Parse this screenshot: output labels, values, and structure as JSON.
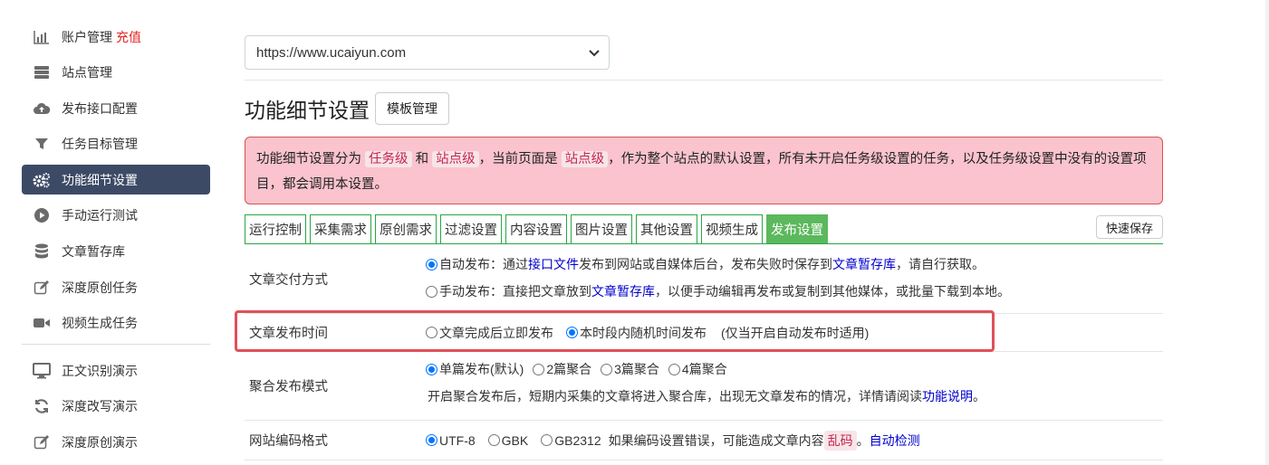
{
  "sidebar": {
    "items": [
      {
        "label": "账户管理",
        "icon": "bar-chart-icon",
        "extra": "充值"
      },
      {
        "label": "站点管理",
        "icon": "server-icon"
      },
      {
        "label": "发布接口配置",
        "icon": "cloud-upload-icon"
      },
      {
        "label": "任务目标管理",
        "icon": "filter-icon"
      },
      {
        "label": "功能细节设置",
        "icon": "gears-icon",
        "active": true
      },
      {
        "label": "手动运行测试",
        "icon": "play-circle-icon"
      },
      {
        "label": "文章暂存库",
        "icon": "database-icon"
      },
      {
        "label": "深度原创任务",
        "icon": "edit-icon"
      },
      {
        "label": "视频生成任务",
        "icon": "video-camera-icon"
      }
    ],
    "demo_items": [
      {
        "label": "正文识别演示",
        "icon": "monitor-icon"
      },
      {
        "label": "深度改写演示",
        "icon": "refresh-icon"
      },
      {
        "label": "深度原创演示",
        "icon": "edit-icon"
      }
    ]
  },
  "main": {
    "site_select_value": "https://www.ucaiyun.com",
    "title": "功能细节设置",
    "template_button": "模板管理",
    "alert": {
      "t1": "功能细节设置分为",
      "c1": "任务级",
      "t2": "和",
      "c2": "站点级",
      "t3": "，当前页面是",
      "c3": "站点级",
      "t4": "，作为整个站点的默认设置，所有未开启任务级设置的任务，以及任务级设置中没有的设置项目，都会调用本设置。"
    },
    "tabs": [
      "运行控制",
      "采集需求",
      "原创需求",
      "过滤设置",
      "内容设置",
      "图片设置",
      "其他设置",
      "视频生成",
      "发布设置"
    ],
    "active_tab": "发布设置",
    "quick_save": "快速保存"
  },
  "settings": {
    "delivery": {
      "label": "文章交付方式",
      "auto_a": "自动发布：通过",
      "auto_link1": "接口文件",
      "auto_b": "发布到网站或自媒体后台，发布失败时保存到",
      "auto_link2": "文章暂存库",
      "auto_c": "，请自行获取。",
      "manual_a": "手动发布：直接把文章放到",
      "manual_link": "文章暂存库",
      "manual_b": "，以便手动编辑再发布或复制到其他媒体，或批量下载到本地。"
    },
    "publish_time": {
      "label": "文章发布时间",
      "opt1": "文章完成后立即发布",
      "opt2": "本时段内随机时间发布",
      "note": "(仅当开启自动发布时适用)"
    },
    "aggregate": {
      "label": "聚合发布模式",
      "opt1": "单篇发布(默认)",
      "opt2": "2篇聚合",
      "opt3": "3篇聚合",
      "opt4": "4篇聚合",
      "desc": "开启聚合发布后，短期内采集的文章将进入聚合库，出现无文章发布的情况，详情请阅读",
      "desc_link": "功能说明",
      "desc_end": "。"
    },
    "encoding": {
      "label": "网站编码格式",
      "opt1": "UTF-8",
      "opt2": "GBK",
      "opt3": "GB2312",
      "note_a": "如果编码设置错误，可能造成文章内容",
      "note_code": "乱码",
      "note_b": "。",
      "link": "自动检测"
    }
  }
}
